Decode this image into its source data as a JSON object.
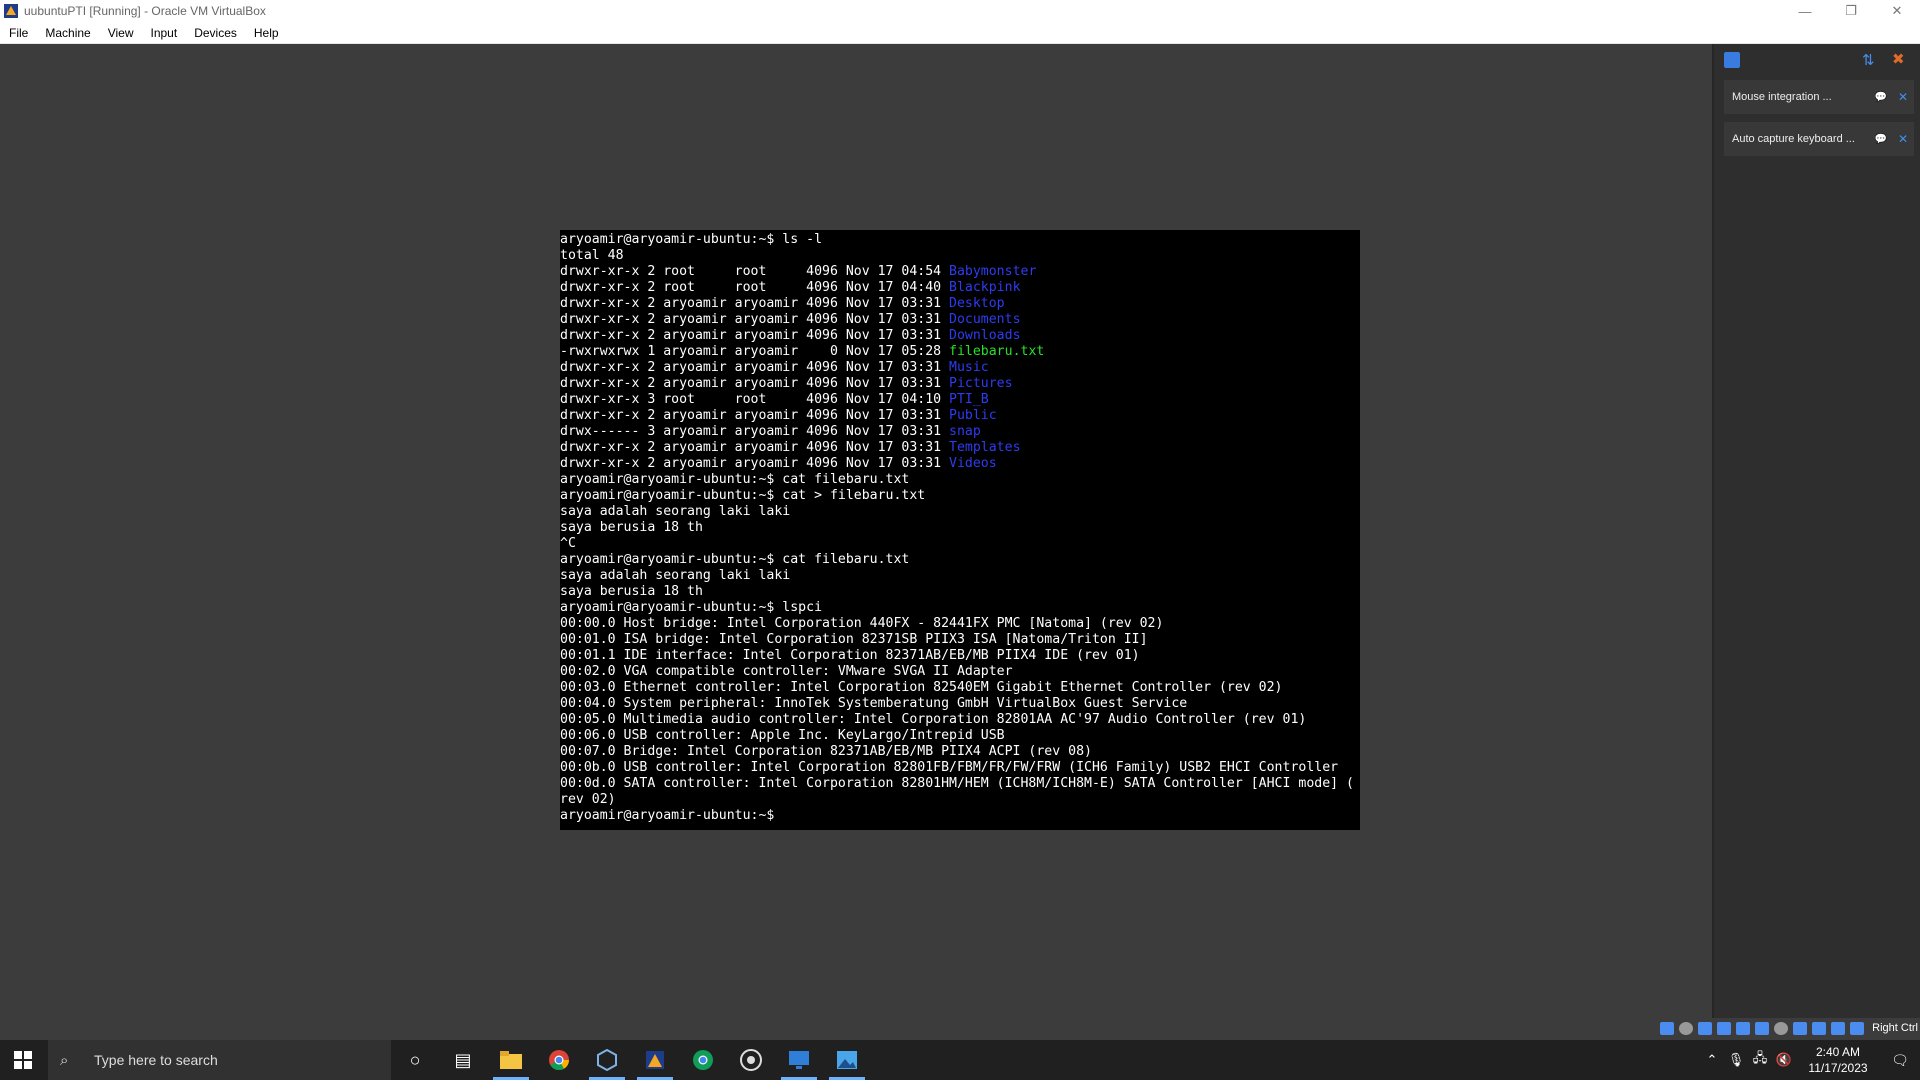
{
  "window": {
    "title": "uubuntuPTI [Running] - Oracle VM VirtualBox",
    "minimize": "—",
    "restore": "❐",
    "close": "✕"
  },
  "menu": [
    "File",
    "Machine",
    "View",
    "Input",
    "Devices",
    "Help"
  ],
  "terminal": {
    "lines": [
      [
        {
          "t": "aryoamir@aryoamir-ubuntu:~$ ls -l"
        }
      ],
      [
        {
          "t": "total 48"
        }
      ],
      [
        {
          "t": "drwxr-xr-x 2 root     root     4096 Nov 17 04:54 "
        },
        {
          "t": "Babymonster",
          "c": "dir"
        }
      ],
      [
        {
          "t": "drwxr-xr-x 2 root     root     4096 Nov 17 04:40 "
        },
        {
          "t": "Blackpink",
          "c": "dir"
        }
      ],
      [
        {
          "t": "drwxr-xr-x 2 aryoamir aryoamir 4096 Nov 17 03:31 "
        },
        {
          "t": "Desktop",
          "c": "dir"
        }
      ],
      [
        {
          "t": "drwxr-xr-x 2 aryoamir aryoamir 4096 Nov 17 03:31 "
        },
        {
          "t": "Documents",
          "c": "dir"
        }
      ],
      [
        {
          "t": "drwxr-xr-x 2 aryoamir aryoamir 4096 Nov 17 03:31 "
        },
        {
          "t": "Downloads",
          "c": "dir"
        }
      ],
      [
        {
          "t": "-rwxrwxrwx 1 aryoamir aryoamir    0 Nov 17 05:28 "
        },
        {
          "t": "filebaru.txt",
          "c": "file"
        }
      ],
      [
        {
          "t": "drwxr-xr-x 2 aryoamir aryoamir 4096 Nov 17 03:31 "
        },
        {
          "t": "Music",
          "c": "dir"
        }
      ],
      [
        {
          "t": "drwxr-xr-x 2 aryoamir aryoamir 4096 Nov 17 03:31 "
        },
        {
          "t": "Pictures",
          "c": "dir"
        }
      ],
      [
        {
          "t": "drwxr-xr-x 3 root     root     4096 Nov 17 04:10 "
        },
        {
          "t": "PTI_B",
          "c": "dir"
        }
      ],
      [
        {
          "t": "drwxr-xr-x 2 aryoamir aryoamir 4096 Nov 17 03:31 "
        },
        {
          "t": "Public",
          "c": "dir"
        }
      ],
      [
        {
          "t": "drwx------ 3 aryoamir aryoamir 4096 Nov 17 03:31 "
        },
        {
          "t": "snap",
          "c": "dir"
        }
      ],
      [
        {
          "t": "drwxr-xr-x 2 aryoamir aryoamir 4096 Nov 17 03:31 "
        },
        {
          "t": "Templates",
          "c": "dir"
        }
      ],
      [
        {
          "t": "drwxr-xr-x 2 aryoamir aryoamir 4096 Nov 17 03:31 "
        },
        {
          "t": "Videos",
          "c": "dir"
        }
      ],
      [
        {
          "t": "aryoamir@aryoamir-ubuntu:~$ cat filebaru.txt"
        }
      ],
      [
        {
          "t": "aryoamir@aryoamir-ubuntu:~$ cat > filebaru.txt"
        }
      ],
      [
        {
          "t": "saya adalah seorang laki laki"
        }
      ],
      [
        {
          "t": "saya berusia 18 th"
        }
      ],
      [
        {
          "t": "^C"
        }
      ],
      [
        {
          "t": "aryoamir@aryoamir-ubuntu:~$ cat filebaru.txt"
        }
      ],
      [
        {
          "t": "saya adalah seorang laki laki"
        }
      ],
      [
        {
          "t": "saya berusia 18 th"
        }
      ],
      [
        {
          "t": "aryoamir@aryoamir-ubuntu:~$ lspci"
        }
      ],
      [
        {
          "t": "00:00.0 Host bridge: Intel Corporation 440FX - 82441FX PMC [Natoma] (rev 02)"
        }
      ],
      [
        {
          "t": "00:01.0 ISA bridge: Intel Corporation 82371SB PIIX3 ISA [Natoma/Triton II]"
        }
      ],
      [
        {
          "t": "00:01.1 IDE interface: Intel Corporation 82371AB/EB/MB PIIX4 IDE (rev 01)"
        }
      ],
      [
        {
          "t": "00:02.0 VGA compatible controller: VMware SVGA II Adapter"
        }
      ],
      [
        {
          "t": "00:03.0 Ethernet controller: Intel Corporation 82540EM Gigabit Ethernet Controller (rev 02)"
        }
      ],
      [
        {
          "t": "00:04.0 System peripheral: InnoTek Systemberatung GmbH VirtualBox Guest Service"
        }
      ],
      [
        {
          "t": "00:05.0 Multimedia audio controller: Intel Corporation 82801AA AC'97 Audio Controller (rev 01)"
        }
      ],
      [
        {
          "t": "00:06.0 USB controller: Apple Inc. KeyLargo/Intrepid USB"
        }
      ],
      [
        {
          "t": "00:07.0 Bridge: Intel Corporation 82371AB/EB/MB PIIX4 ACPI (rev 08)"
        }
      ],
      [
        {
          "t": "00:0b.0 USB controller: Intel Corporation 82801FB/FBM/FR/FW/FRW (ICH6 Family) USB2 EHCI Controller"
        }
      ],
      [
        {
          "t": "00:0d.0 SATA controller: Intel Corporation 82801HM/HEM (ICH8M/ICH8M-E) SATA Controller [AHCI mode] ("
        }
      ],
      [
        {
          "t": "rev 02)"
        }
      ],
      [
        {
          "t": "aryoamir@aryoamir-ubuntu:~$ "
        }
      ]
    ]
  },
  "notifications": [
    {
      "text": "Mouse integration ...",
      "icon": "speech-bubble-icon",
      "close": "✕"
    },
    {
      "text": "Auto capture keyboard ...",
      "icon": "speech-bubble-icon",
      "close": "✕"
    }
  ],
  "statusbar": {
    "host_key": "Right Ctrl"
  },
  "taskbar": {
    "search_placeholder": "Type here to search",
    "time": "2:40 AM",
    "date": "11/17/2023"
  },
  "colors": {
    "terminal_bg": "#000000",
    "dir": "#2e3cf0",
    "file": "#27e027",
    "vm_background": "#3c3c3c"
  }
}
